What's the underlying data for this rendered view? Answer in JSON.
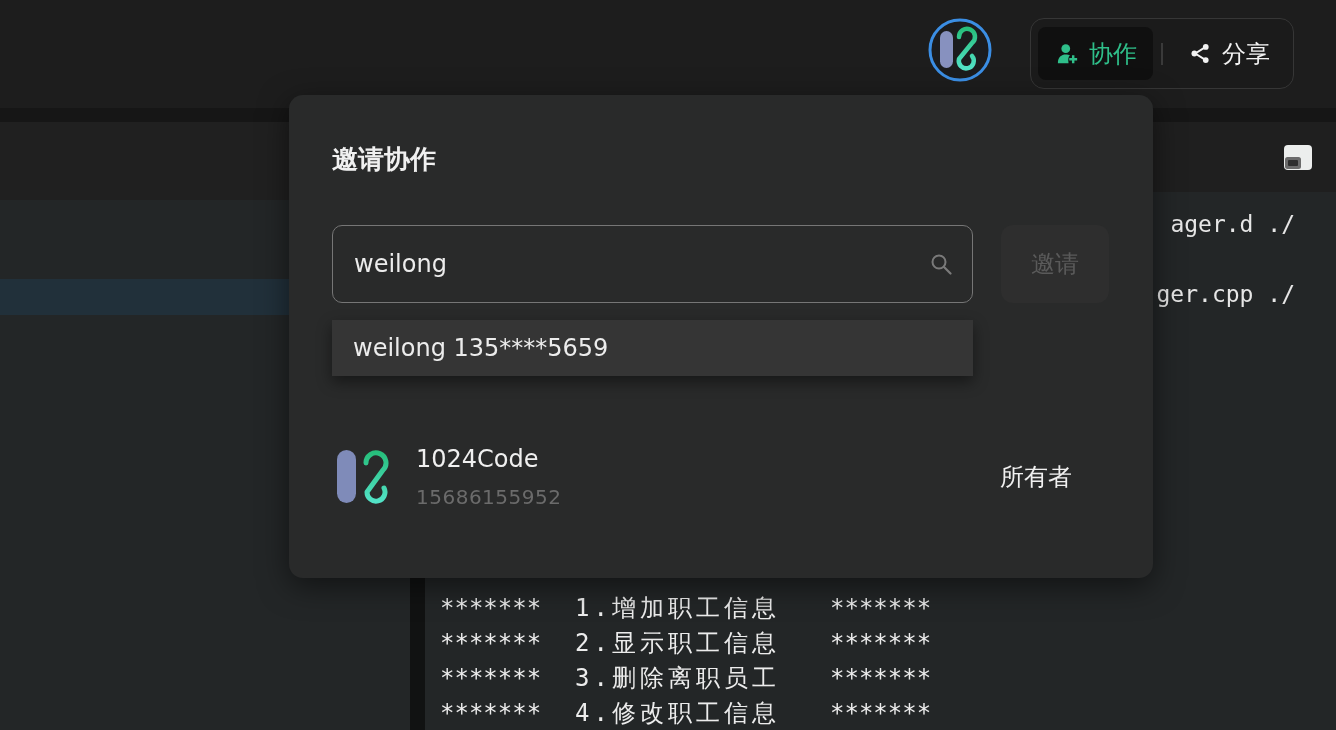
{
  "top_bar": {
    "actions": [
      {
        "kind": "collaborate",
        "label": "协作",
        "selected": true
      },
      {
        "kind": "share",
        "label": "分享",
        "selected": false
      }
    ]
  },
  "editor": {
    "code_lines": [
      "ager.d ./",
      "ger.cpp ./"
    ]
  },
  "terminal": {
    "lines": [
      {
        "left": "*******",
        "text": "1.增加职工信息",
        "right": "*******"
      },
      {
        "left": "*******",
        "text": "2.显示职工信息",
        "right": "*******"
      },
      {
        "left": "*******",
        "text": "3.删除离职员工",
        "right": "*******"
      },
      {
        "left": "*******",
        "text": "4.修改职工信息",
        "right": "*******"
      }
    ]
  },
  "dialog": {
    "title": "邀请协作",
    "search": {
      "value": "weilong"
    },
    "invite_button": {
      "label": "邀请",
      "disabled": true
    },
    "suggestions": [
      {
        "label": "weilong 135****5659"
      }
    ],
    "members": [
      {
        "name": "1024Code",
        "phone": "15686155952",
        "role": "所有者"
      }
    ]
  }
}
